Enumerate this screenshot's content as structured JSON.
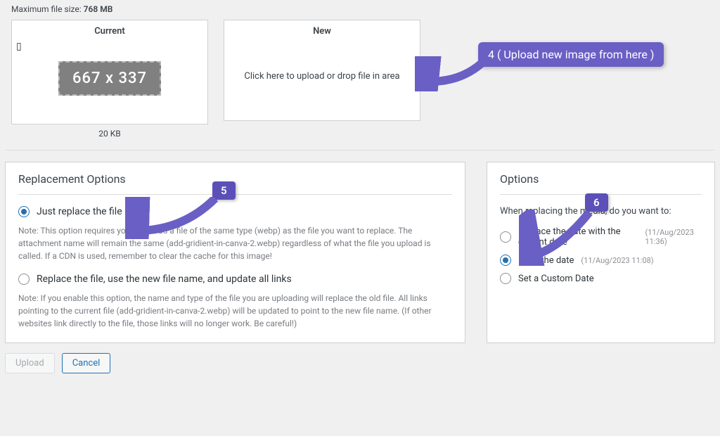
{
  "header": {
    "max_file_label": "Maximum file size:",
    "max_file_value": "768 MB"
  },
  "preview": {
    "current_title": "Current",
    "current_placeholder": "667 x 337",
    "current_size": "20 KB",
    "new_title": "New",
    "new_prompt": "Click here to upload or drop file in area"
  },
  "replacement": {
    "title": "Replacement Options",
    "opt1_label": "Just replace the file",
    "opt1_note": "Note: This option requires you to upload a file of the same type (webp) as the file you want to replace. The attachment name will remain the same (add-gridient-in-canva-2.webp) regardless of what the file you upload is called. If a CDN is used, remember to clear the cache for this image!",
    "opt2_label": "Replace the file, use the new file name, and update all links",
    "opt2_note": "Note: If you enable this option, the name and type of the file you are uploading will replace the old file. All links pointing to the current file (add-gridient-in-canva-2.webp) will be updated to point to the new file name. (If other websites link directly to the file, those links will no longer work. Be careful!)"
  },
  "options": {
    "title": "Options",
    "lead": "When replacing the media, do you want to:",
    "opt1_label": "Replace the date with the current date",
    "opt1_meta": "(11/Aug/2023 11:36)",
    "opt2_label": "Keep the date",
    "opt2_meta": "(11/Aug/2023 11:08)",
    "opt3_label": "Set a Custom Date"
  },
  "buttons": {
    "upload": "Upload",
    "cancel": "Cancel"
  },
  "annotations": {
    "a4": "4 ( Upload new image from here )",
    "a5": "5",
    "a6": "6"
  }
}
